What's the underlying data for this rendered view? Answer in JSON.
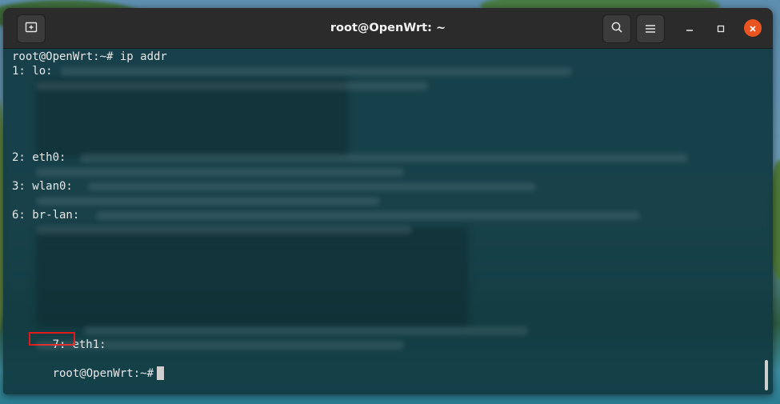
{
  "window": {
    "title": "root@OpenWrt: ~",
    "new_tab_icon": "new-tab-icon",
    "search_icon": "search-icon",
    "menu_icon": "hamburger-menu-icon",
    "minimize_icon": "minimize-icon",
    "maximize_icon": "maximize-icon",
    "close_icon": "close-icon",
    "close_color": "#e95420"
  },
  "terminal": {
    "prompt_command": "root@OpenWrt:~# ip addr",
    "interfaces": [
      {
        "index_label": "1: lo:"
      },
      {
        "index_label": "2: eth0:"
      },
      {
        "index_label": "3: wlan0:"
      },
      {
        "index_label": "6: br-lan:"
      },
      {
        "index_prefix": "7:",
        "name": "eth1:"
      }
    ],
    "final_prompt": "root@OpenWrt:~#",
    "highlight_color": "#e01b1b"
  }
}
